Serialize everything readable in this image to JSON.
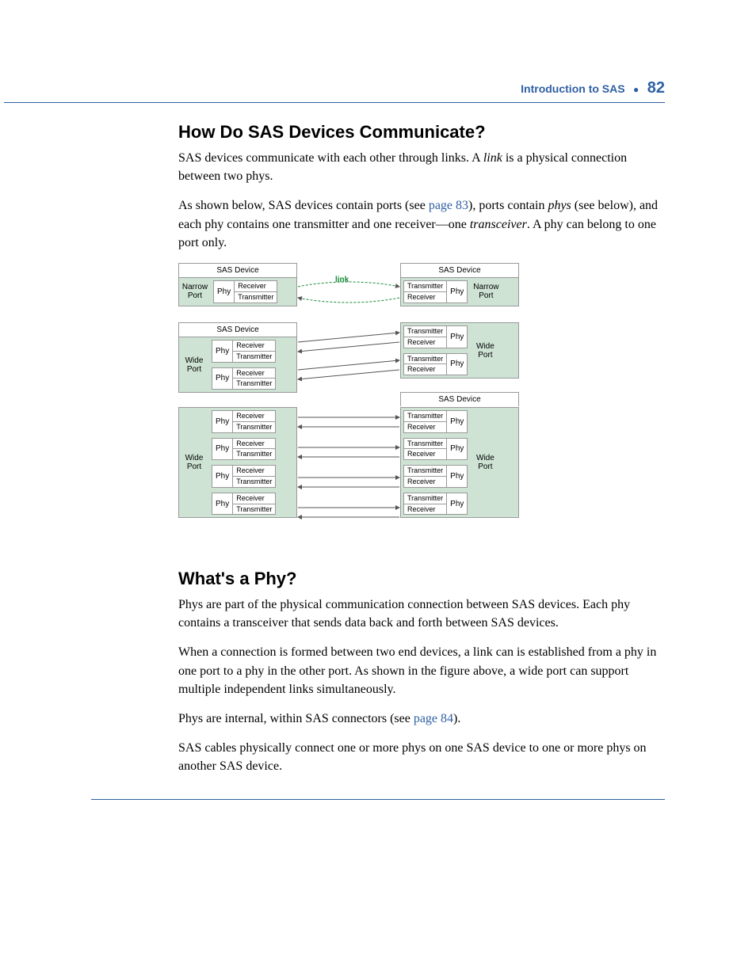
{
  "header": {
    "section": "Introduction to SAS",
    "page": "82"
  },
  "s1": {
    "heading": "How Do SAS Devices Communicate?",
    "p1a": "SAS devices communicate with each other through links. A ",
    "p1b": "link",
    "p1c": " is a physical connection between two phys.",
    "p2a": "As shown below, SAS devices contain ports (see ",
    "p2link": "page 83",
    "p2b": "), ports contain ",
    "p2c": "phys",
    "p2d": " (see below), and each phy contains one transmitter and one receiver—one ",
    "p2e": "transceiver",
    "p2f": ". A phy can belong to one port only."
  },
  "diagram": {
    "sas_device": "SAS Device",
    "narrow_port": "Narrow Port",
    "wide_port": "Wide Port",
    "phy": "Phy",
    "receiver": "Receiver",
    "transmitter": "Transmitter",
    "link": "link"
  },
  "s2": {
    "heading": "What's a Phy?",
    "p1": "Phys are part of the physical communication connection between SAS devices. Each phy contains a transceiver that sends data back and forth between SAS devices.",
    "p2": "When a connection is formed between two end devices, a link can is established from a phy in one port to a phy in the other port. As shown in the figure above, a wide port can support multiple independent links simultaneously.",
    "p3a": "Phys are internal, within SAS connectors (see ",
    "p3link": "page 84",
    "p3b": ").",
    "p4": "SAS cables physically connect one or more phys on one SAS device to one or more phys on another SAS device."
  }
}
